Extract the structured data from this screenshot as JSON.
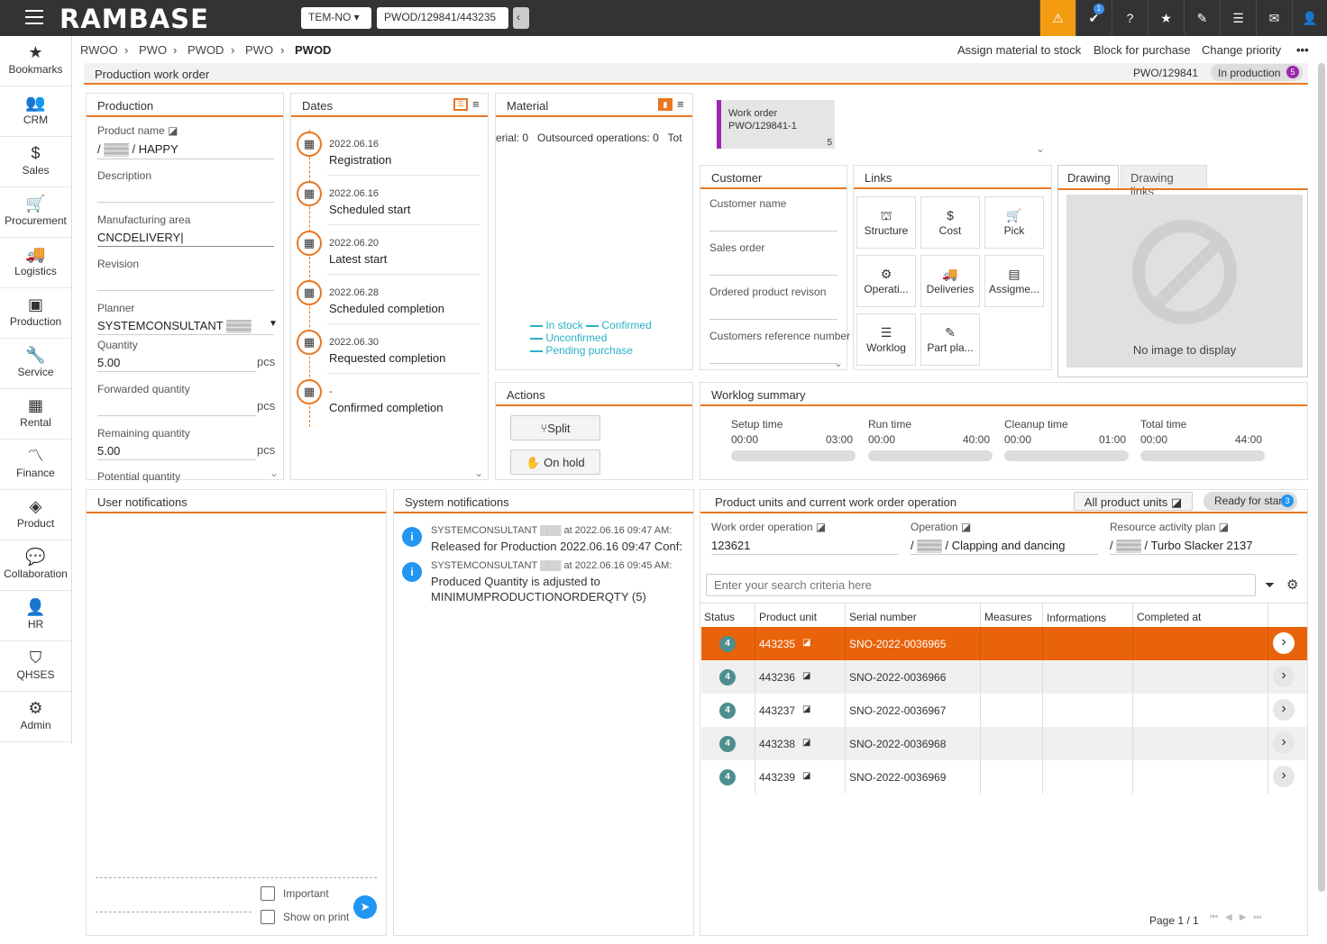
{
  "topbar": {
    "logo": "RAMBASE",
    "company": "TEM-NO",
    "path": "PWOD/129841/443235",
    "notif_count": "1"
  },
  "sidebar": [
    "Bookmarks",
    "CRM",
    "Sales",
    "Procurement",
    "Logistics",
    "Production",
    "Service",
    "Rental",
    "Finance",
    "Product",
    "Collaboration",
    "HR",
    "QHSES",
    "Admin"
  ],
  "breadcrumb": [
    "RWOO",
    "PWO",
    "PWOD",
    "PWO",
    "PWOD"
  ],
  "actions": [
    "Assign material to stock",
    "Block for purchase",
    "Change priority"
  ],
  "header": {
    "title": "Production work order",
    "id": "PWO/129841",
    "status": "In production",
    "status_count": "5"
  },
  "production": {
    "title": "Production",
    "product_name_label": "Product name",
    "product_name": "/ ▒▒▒ / HAPPY",
    "description_label": "Description",
    "manufacturing_area_label": "Manufacturing area",
    "manufacturing_area": "CNCDELIVERY|",
    "revision_label": "Revision",
    "planner_label": "Planner",
    "planner": "SYSTEMCONSULTANT ▒▒▒",
    "quantity_label": "Quantity",
    "quantity": "5.00",
    "unit": "pcs",
    "forwarded_label": "Forwarded quantity",
    "remaining_label": "Remaining quantity",
    "remaining": "5.00",
    "potential_label": "Potential quantity"
  },
  "dates": {
    "title": "Dates",
    "items": [
      {
        "date": "2022.06.16",
        "label": "Registration"
      },
      {
        "date": "2022.06.16",
        "label": "Scheduled start"
      },
      {
        "date": "2022.06.20",
        "label": "Latest start"
      },
      {
        "date": "2022.06.28",
        "label": "Scheduled completion"
      },
      {
        "date": "2022.06.30",
        "label": "Requested completion"
      },
      {
        "date": "-",
        "label": "Confirmed completion"
      }
    ]
  },
  "material": {
    "title": "Material",
    "summary": "erial: 0   Outsourced operations: 0   Tot",
    "legend": [
      "In stock",
      "Confirmed",
      "Unconfirmed",
      "Pending purchase"
    ]
  },
  "workorder": {
    "line1": "Work order",
    "line2": "PWO/129841-1",
    "count": "5"
  },
  "customer": {
    "title": "Customer",
    "fields": [
      "Customer name",
      "Sales order",
      "Ordered product revison",
      "Customers reference number"
    ]
  },
  "links": {
    "title": "Links",
    "items": [
      "Structure",
      "Cost",
      "Pick",
      "Operati...",
      "Deliveries",
      "Assigme...",
      "Worklog",
      "Part pla..."
    ]
  },
  "drawing": {
    "tab1": "Drawing",
    "tab2": "Drawing links",
    "empty": "No image to display"
  },
  "actions_panel": {
    "title": "Actions",
    "split": "Split",
    "hold": "On hold"
  },
  "worklog": {
    "title": "Worklog summary",
    "items": [
      {
        "label": "Setup time",
        "from": "00:00",
        "to": "03:00"
      },
      {
        "label": "Run time",
        "from": "00:00",
        "to": "40:00"
      },
      {
        "label": "Cleanup time",
        "from": "00:00",
        "to": "01:00"
      },
      {
        "label": "Total time",
        "from": "00:00",
        "to": "44:00"
      }
    ]
  },
  "user_notif": {
    "title": "User notifications",
    "important": "Important",
    "show_print": "Show on print"
  },
  "sys_notif": {
    "title": "System notifications",
    "items": [
      {
        "head": "SYSTEMCONSULTANT ▒▒▒ at 2022.06.16 09:47 AM:",
        "body": "Released for Production 2022.06.16 09:47 Conf:"
      },
      {
        "head": "SYSTEMCONSULTANT ▒▒▒ at 2022.06.16 09:45 AM:",
        "body": "Produced Quantity is adjusted to MINIMUMPRODUCTIONORDERQTY (5)"
      }
    ]
  },
  "units": {
    "title": "Product units and current work order operation",
    "all_btn": "All product units",
    "ready": "Ready for start",
    "ready_count": "3",
    "wo_op_label": "Work order operation",
    "wo_op": "123621",
    "op_label": "Operation",
    "op": "/ ▒▒▒ / Clapping and dancing",
    "rap_label": "Resource activity plan",
    "rap": "/ ▒▒▒ / Turbo Slacker 2137",
    "search_placeholder": "Enter your search criteria here",
    "columns": [
      "Status",
      "Product unit",
      "Serial number",
      "Measures",
      "Informations",
      "Completed at"
    ],
    "rows": [
      {
        "status": "4",
        "unit": "443235",
        "serial": "SNO-2022-0036965"
      },
      {
        "status": "4",
        "unit": "443236",
        "serial": "SNO-2022-0036966"
      },
      {
        "status": "4",
        "unit": "443237",
        "serial": "SNO-2022-0036967"
      },
      {
        "status": "4",
        "unit": "443238",
        "serial": "SNO-2022-0036968"
      },
      {
        "status": "4",
        "unit": "443239",
        "serial": "SNO-2022-0036969"
      }
    ],
    "page": "Page 1 / 1"
  }
}
